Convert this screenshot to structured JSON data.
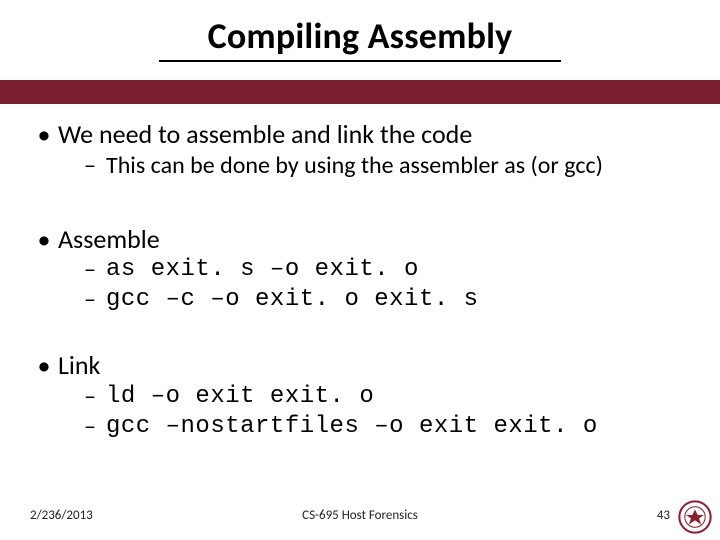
{
  "title": "Compiling Assembly",
  "bullets": {
    "b1": {
      "label": "We need to assemble and link the code",
      "sub1": "This can be done by using the assembler as (or gcc)"
    },
    "b2": {
      "label": "Assemble",
      "sub1": "as exit. s –o exit. o",
      "sub2": "gcc –c –o exit. o exit. s"
    },
    "b3": {
      "label": "Link",
      "sub1": "ld –o exit exit. o",
      "sub2": "gcc –nostartfiles –o exit exit. o"
    }
  },
  "footer": {
    "date": "2/236/2013",
    "course": "CS-695 Host Forensics",
    "page": "43"
  }
}
